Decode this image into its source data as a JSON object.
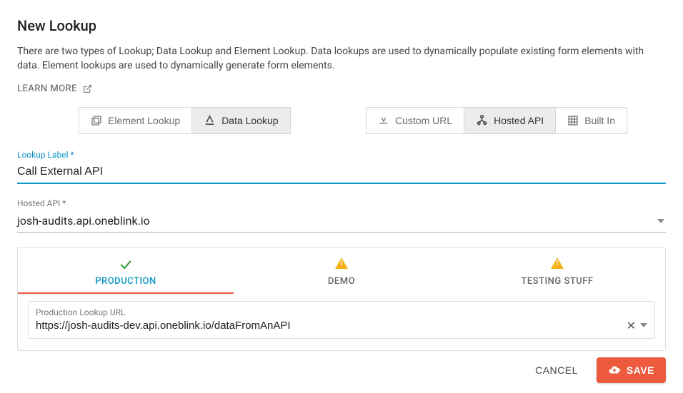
{
  "header": {
    "title": "New Lookup",
    "description": "There are two types of Lookup; Data Lookup and Element Lookup. Data lookups are used to dynamically populate existing form elements with data. Element lookups are used to dynamically generate form elements.",
    "learn_more": "LEARN MORE"
  },
  "toggles": {
    "type": [
      {
        "key": "element",
        "label": "Element Lookup",
        "active": false
      },
      {
        "key": "data",
        "label": "Data Lookup",
        "active": true
      }
    ],
    "source": [
      {
        "key": "custom",
        "label": "Custom URL",
        "active": false
      },
      {
        "key": "hosted",
        "label": "Hosted API",
        "active": true
      },
      {
        "key": "builtin",
        "label": "Built In",
        "active": false
      }
    ]
  },
  "fields": {
    "label_title": "Lookup Label *",
    "label_value": "Call External API",
    "hosted_title": "Hosted API *",
    "hosted_value": "josh-audits.api.oneblink.io"
  },
  "env": {
    "tabs": [
      {
        "key": "prod",
        "label": "PRODUCTION",
        "status": "ok",
        "active": true
      },
      {
        "key": "demo",
        "label": "DEMO",
        "status": "warn",
        "active": false
      },
      {
        "key": "test",
        "label": "TESTING STUFF",
        "status": "warn",
        "active": false
      }
    ],
    "url_label": "Production Lookup URL",
    "url_value": "https://josh-audits-dev.api.oneblink.io/dataFromAnAPI"
  },
  "footer": {
    "cancel": "CANCEL",
    "save": "SAVE"
  }
}
